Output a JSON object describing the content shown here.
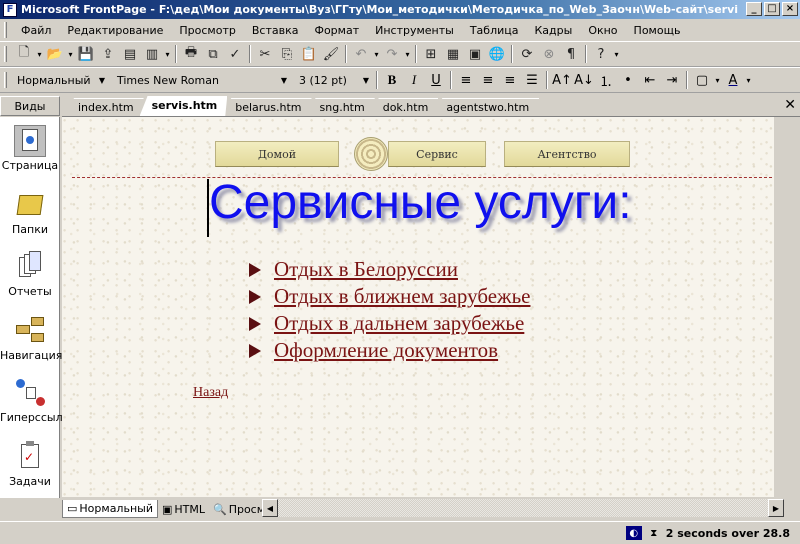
{
  "window": {
    "title": "Microsoft FrontPage - F:\\дед\\Мои документы\\Вуз\\ГГту\\Мои_методички\\Методичка_по_Web_Заочн\\Web-сайт\\servi..."
  },
  "menu": [
    "Файл",
    "Редактирование",
    "Просмотр",
    "Вставка",
    "Формат",
    "Инструменты",
    "Таблица",
    "Кадры",
    "Окно",
    "Помощь"
  ],
  "format": {
    "style": "Нормальный",
    "font": "Times New Roman",
    "size": "3  (12 pt)"
  },
  "views": {
    "header": "Виды",
    "items": [
      {
        "label": "Страница",
        "icon": "page-icon"
      },
      {
        "label": "Папки",
        "icon": "folder-icon"
      },
      {
        "label": "Отчеты",
        "icon": "reports-icon"
      },
      {
        "label": "Навигация",
        "icon": "navigation-icon"
      },
      {
        "label": "Гиперссылк",
        "icon": "hyperlinks-icon"
      },
      {
        "label": "Задачи",
        "icon": "tasks-icon"
      }
    ]
  },
  "tabs": [
    "index.htm",
    "servis.htm",
    "belarus.htm",
    "sng.htm",
    "dok.htm",
    "agentstwo.htm"
  ],
  "page": {
    "nav": [
      "Домой",
      "Сервис",
      "Агентство"
    ],
    "heading": "Сервисные услуги:",
    "links": [
      "Отдых в Белоруссии",
      "Отдых в ближнем зарубежье",
      "Отдых в дальнем зарубежье",
      "Оформление документов"
    ],
    "back": "Назад"
  },
  "mode_tabs": [
    "Нормальный",
    "HTML",
    "Просмотр"
  ],
  "status": {
    "download_time": "2 seconds over 28.8"
  },
  "colors": {
    "heading": "#1010ee",
    "link": "#7a1313",
    "title_bar": "#0a246a"
  }
}
